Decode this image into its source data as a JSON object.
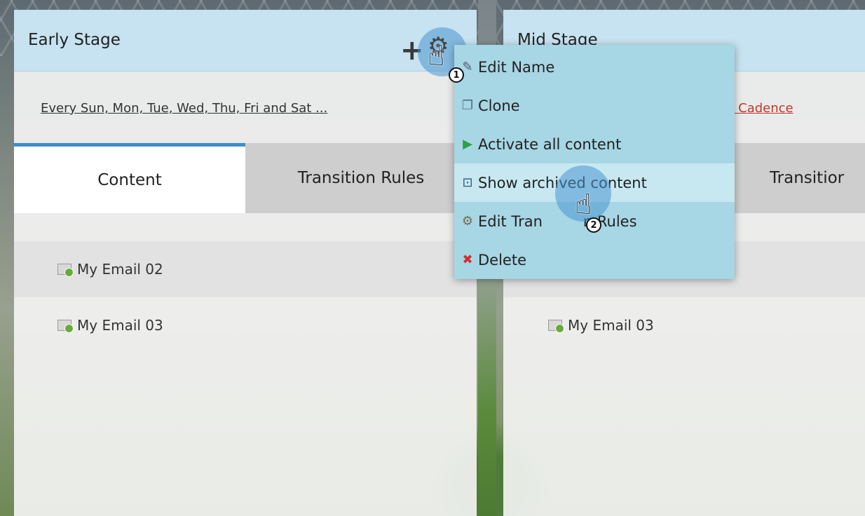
{
  "early_stage": {
    "title": "Early Stage",
    "schedule": "Every Sun, Mon, Tue, Wed, Thu, Fri and Sat ...",
    "tabs": {
      "content": "Content",
      "rules": "Transition Rules"
    },
    "items": [
      "My Email 02",
      "My Email 03"
    ]
  },
  "mid_stage": {
    "title": "Mid Stage",
    "cadence": "n Cadence",
    "tabs": {
      "rules": "Transitior"
    },
    "items": [
      "My Email 03"
    ]
  },
  "menu": {
    "items": [
      {
        "label": "Edit Name",
        "icon": "pencil-icon"
      },
      {
        "label": "Clone",
        "icon": "clone-icon"
      },
      {
        "label": "Activate all content",
        "icon": "play-icon"
      },
      {
        "label": "Show archived content",
        "icon": "archive-icon"
      },
      {
        "label": "Edit Tran",
        "icon": "rules-icon"
      },
      {
        "label": "Delete",
        "icon": "delete-icon"
      }
    ],
    "label_tail": "n Rules"
  },
  "markers": {
    "one": "1",
    "two": "2"
  },
  "colors": {
    "header_bg": "#c5e1f0",
    "menu_bg": "#a7d6e4",
    "menu_hover": "#c7e8f1",
    "active_tab": "#3c8fc9",
    "link_red": "#c0392b"
  }
}
